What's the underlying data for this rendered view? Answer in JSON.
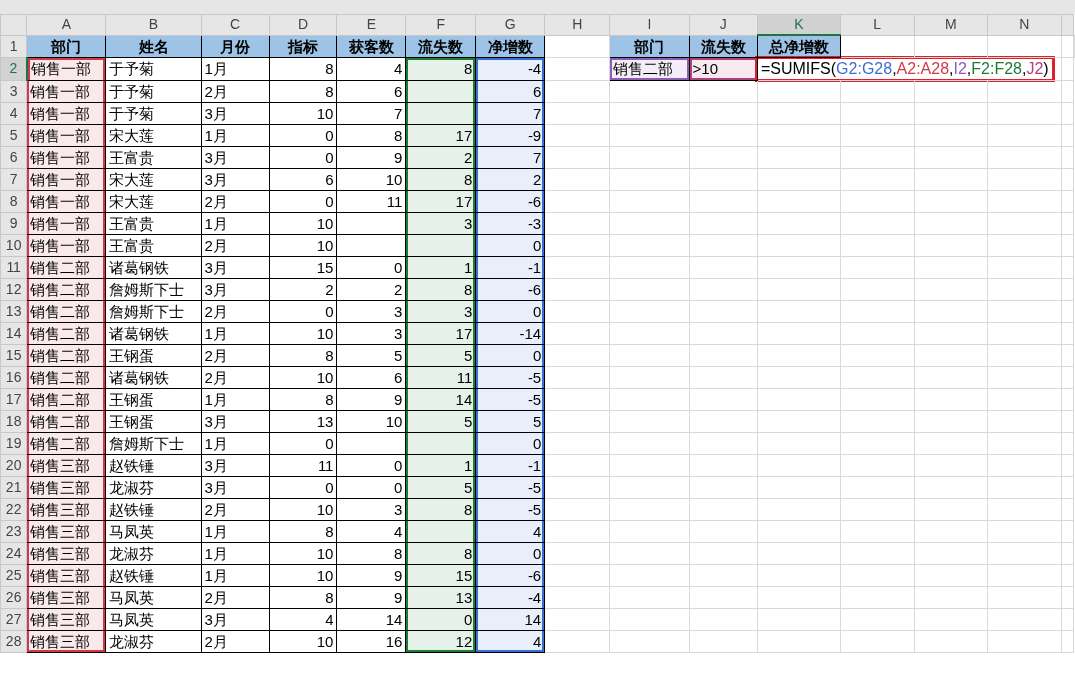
{
  "column_letters": [
    {
      "label": "A",
      "selected": false
    },
    {
      "label": "B",
      "selected": false
    },
    {
      "label": "C",
      "selected": false
    },
    {
      "label": "D",
      "selected": false
    },
    {
      "label": "E",
      "selected": false
    },
    {
      "label": "F",
      "selected": false
    },
    {
      "label": "G",
      "selected": false
    },
    {
      "label": "H",
      "selected": false
    },
    {
      "label": "I",
      "selected": false
    },
    {
      "label": "J",
      "selected": false
    },
    {
      "label": "K",
      "selected": true
    },
    {
      "label": "L",
      "selected": false
    },
    {
      "label": "M",
      "selected": false
    },
    {
      "label": "N",
      "selected": false
    }
  ],
  "row_numbers": [
    {
      "label": "1",
      "selected": false
    },
    {
      "label": "2",
      "selected": true
    },
    {
      "label": "3",
      "selected": false
    },
    {
      "label": "4",
      "selected": false
    },
    {
      "label": "5",
      "selected": false
    },
    {
      "label": "6",
      "selected": false
    },
    {
      "label": "7",
      "selected": false
    },
    {
      "label": "8",
      "selected": false
    },
    {
      "label": "9",
      "selected": false
    },
    {
      "label": "10",
      "selected": false
    },
    {
      "label": "11",
      "selected": false
    },
    {
      "label": "12",
      "selected": false
    },
    {
      "label": "13",
      "selected": false
    },
    {
      "label": "14",
      "selected": false
    },
    {
      "label": "15",
      "selected": false
    },
    {
      "label": "16",
      "selected": false
    },
    {
      "label": "17",
      "selected": false
    },
    {
      "label": "18",
      "selected": false
    },
    {
      "label": "19",
      "selected": false
    },
    {
      "label": "20",
      "selected": false
    },
    {
      "label": "21",
      "selected": false
    },
    {
      "label": "22",
      "selected": false
    },
    {
      "label": "23",
      "selected": false
    },
    {
      "label": "24",
      "selected": false
    },
    {
      "label": "25",
      "selected": false
    },
    {
      "label": "26",
      "selected": false
    },
    {
      "label": "27",
      "selected": false
    },
    {
      "label": "28",
      "selected": false
    }
  ],
  "table": {
    "columns": [
      {
        "label": "部门",
        "kind": "text",
        "color": "#d03a48"
      },
      {
        "label": "姓名",
        "kind": "text"
      },
      {
        "label": "月份",
        "kind": "text"
      },
      {
        "label": "指标",
        "kind": "number"
      },
      {
        "label": "获客数",
        "kind": "number"
      },
      {
        "label": "流失数",
        "kind": "number",
        "color": "#1e7b34"
      },
      {
        "label": "净增数",
        "kind": "number",
        "color": "#3a6fd0"
      }
    ],
    "rows": [
      [
        "销售一部",
        "于予菊",
        "1月",
        "8",
        "4",
        "8",
        "-4"
      ],
      [
        "销售一部",
        "于予菊",
        "2月",
        "8",
        "6",
        null,
        "6"
      ],
      [
        "销售一部",
        "于予菊",
        "3月",
        "10",
        "7",
        null,
        "7"
      ],
      [
        "销售一部",
        "宋大莲",
        "1月",
        "0",
        "8",
        "17",
        "-9"
      ],
      [
        "销售一部",
        "王富贵",
        "3月",
        "0",
        "9",
        "2",
        "7"
      ],
      [
        "销售一部",
        "宋大莲",
        "3月",
        "6",
        "10",
        "8",
        "2"
      ],
      [
        "销售一部",
        "宋大莲",
        "2月",
        "0",
        "11",
        "17",
        "-6"
      ],
      [
        "销售一部",
        "王富贵",
        "1月",
        "10",
        null,
        "3",
        "-3"
      ],
      [
        "销售一部",
        "王富贵",
        "2月",
        "10",
        null,
        null,
        "0"
      ],
      [
        "销售二部",
        "诸葛钢铁",
        "3月",
        "15",
        "0",
        "1",
        "-1"
      ],
      [
        "销售二部",
        "詹姆斯下士",
        "3月",
        "2",
        "2",
        "8",
        "-6"
      ],
      [
        "销售二部",
        "詹姆斯下士",
        "2月",
        "0",
        "3",
        "3",
        "0"
      ],
      [
        "销售二部",
        "诸葛钢铁",
        "1月",
        "10",
        "3",
        "17",
        "-14"
      ],
      [
        "销售二部",
        "王钢蛋",
        "2月",
        "8",
        "5",
        "5",
        "0"
      ],
      [
        "销售二部",
        "诸葛钢铁",
        "2月",
        "10",
        "6",
        "11",
        "-5"
      ],
      [
        "销售二部",
        "王钢蛋",
        "1月",
        "8",
        "9",
        "14",
        "-5"
      ],
      [
        "销售二部",
        "王钢蛋",
        "3月",
        "13",
        "10",
        "5",
        "5"
      ],
      [
        "销售二部",
        "詹姆斯下士",
        "1月",
        "0",
        null,
        null,
        "0"
      ],
      [
        "销售三部",
        "赵铁锤",
        "3月",
        "11",
        "0",
        "1",
        "-1"
      ],
      [
        "销售三部",
        "龙淑芬",
        "3月",
        "0",
        "0",
        "5",
        "-5"
      ],
      [
        "销售三部",
        "赵铁锤",
        "2月",
        "10",
        "3",
        "8",
        "-5"
      ],
      [
        "销售三部",
        "马凤英",
        "1月",
        "8",
        "4",
        null,
        "4"
      ],
      [
        "销售三部",
        "龙淑芬",
        "1月",
        "10",
        "8",
        "8",
        "0"
      ],
      [
        "销售三部",
        "赵铁锤",
        "1月",
        "10",
        "9",
        "15",
        "-6"
      ],
      [
        "销售三部",
        "马凤英",
        "2月",
        "8",
        "9",
        "13",
        "-4"
      ],
      [
        "销售三部",
        "马凤英",
        "3月",
        "4",
        "14",
        "0",
        "14"
      ],
      [
        "销售三部",
        "龙淑芬",
        "2月",
        "10",
        "16",
        "12",
        "4"
      ]
    ]
  },
  "criteria": {
    "columns": [
      "部门",
      "流失数",
      "总净增数"
    ],
    "cells": [
      {
        "text": "销售二部",
        "color": "#8e5cb8"
      },
      {
        "text": ">10",
        "color": "#b0407a"
      }
    ],
    "formula": {
      "highlighted": true,
      "segments": [
        {
          "text": "=SUMIFS("
        },
        {
          "text": "G2:G28",
          "color": "#3a6fd0"
        },
        {
          "text": ","
        },
        {
          "text": "A2:A28",
          "color": "#d03a48"
        },
        {
          "text": ","
        },
        {
          "text": "I2",
          "color": "#8e5cb8"
        },
        {
          "text": ","
        },
        {
          "text": "F2:F28",
          "color": "#1e7b34"
        },
        {
          "text": ","
        },
        {
          "text": "J2",
          "color": "#b0407a"
        },
        {
          "text": ")"
        }
      ]
    }
  }
}
